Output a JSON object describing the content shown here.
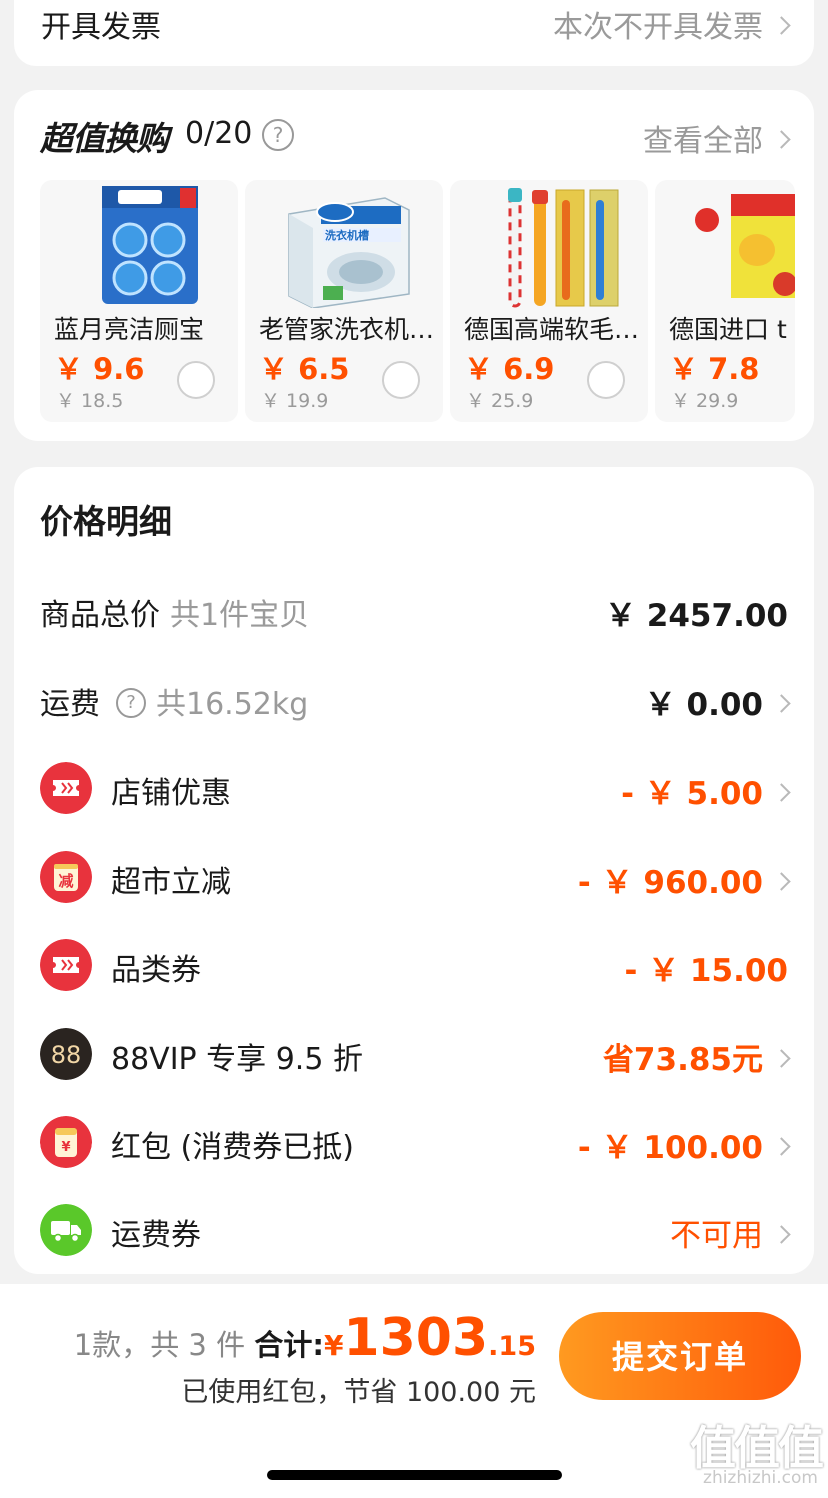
{
  "invoice": {
    "label": "开具发票",
    "value": "本次不开具发票"
  },
  "swap": {
    "title": "超值换购",
    "count": "0/20",
    "help": "?",
    "view_all": "查看全部",
    "products": [
      {
        "name": "蓝月亮洁厕宝",
        "price": "￥ 9.6",
        "original": "￥ 18.5",
        "image": "toilet-cleaner-tablets"
      },
      {
        "name": "老管家洗衣机槽清洁块",
        "price": "￥ 6.5",
        "original": "￥ 19.9",
        "image": "washing-machine-cleaner"
      },
      {
        "name": "德国高端软毛儿童牙刷",
        "price": "￥ 6.9",
        "original": "￥ 25.9",
        "image": "toothbrushes"
      },
      {
        "name": "德国进口 t",
        "price": "￥ 7.8",
        "original": "￥ 29.9",
        "image": "toothpaste"
      }
    ]
  },
  "detail": {
    "heading": "价格明细",
    "rows": [
      {
        "label": "商品总价",
        "sub": "共1件宝贝",
        "value": "￥ 2457.00"
      },
      {
        "label": "运费",
        "sub": "共16.52kg",
        "value": "￥ 0.00"
      },
      {
        "label": "店铺优惠",
        "value": "- ￥ 5.00",
        "icon": "ticket-icon"
      },
      {
        "label": "超市立减",
        "value": "- ￥ 960.00",
        "icon": "reduce-icon",
        "icon_text": "减"
      },
      {
        "label": "品类券",
        "value": "- ￥ 15.00",
        "icon": "ticket-icon"
      },
      {
        "label": "88VIP 专享 9.5 折",
        "value": "省73.85元",
        "icon": "vip-icon",
        "icon_text": "88"
      },
      {
        "label": "红包 (消费券已抵)",
        "value": "- ￥ 100.00",
        "icon": "red-packet-icon",
        "icon_text": "¥"
      },
      {
        "label": "运费券",
        "value": "不可用",
        "icon": "truck-icon"
      }
    ]
  },
  "bottom": {
    "summary": "1款，共 3 件",
    "total_label": "合计:",
    "currency": "¥",
    "total_int": "1303",
    "total_dec": ".15",
    "saved": "已使用红包，节省 100.00 元",
    "submit": "提交订单"
  },
  "watermark": {
    "big": "值值值",
    "small": "zhizhizhi.com"
  },
  "colors": {
    "accent": "#ff5000",
    "red_icon": "#e8333d",
    "green_icon": "#5ac82a",
    "vip_icon": "#2a2420"
  }
}
